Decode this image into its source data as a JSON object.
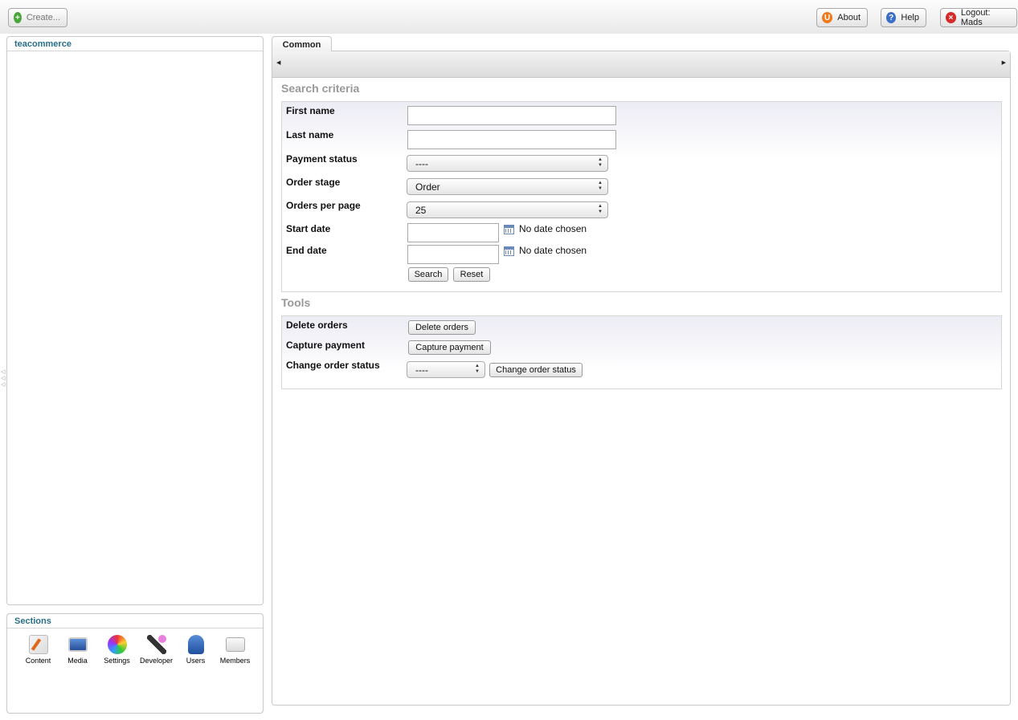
{
  "topbar": {
    "create_label": "Create...",
    "about_label": "About",
    "help_label": "Help",
    "logout_label": "Logout: Mads"
  },
  "tree": {
    "title": "teacommerce"
  },
  "sections": {
    "title": "Sections",
    "items": [
      {
        "label": "Content",
        "icon": "content-icon"
      },
      {
        "label": "Media",
        "icon": "media-icon"
      },
      {
        "label": "Settings",
        "icon": "settings-icon"
      },
      {
        "label": "Developer",
        "icon": "developer-icon"
      },
      {
        "label": "Users",
        "icon": "users-icon"
      },
      {
        "label": "Members",
        "icon": "members-icon"
      }
    ]
  },
  "main": {
    "tab": "Common",
    "search": {
      "title": "Search criteria",
      "first_name_label": "First name",
      "first_name_value": "",
      "last_name_label": "Last name",
      "last_name_value": "",
      "payment_status_label": "Payment status",
      "payment_status_value": "----",
      "order_stage_label": "Order stage",
      "order_stage_value": "Order",
      "orders_per_page_label": "Orders per page",
      "orders_per_page_value": "25",
      "start_date_label": "Start date",
      "start_date_text": "No date chosen",
      "end_date_label": "End date",
      "end_date_text": "No date chosen",
      "search_button": "Search",
      "reset_button": "Reset"
    },
    "tools": {
      "title": "Tools",
      "delete_label": "Delete orders",
      "delete_button": "Delete orders",
      "capture_label": "Capture payment",
      "capture_button": "Capture payment",
      "change_status_label": "Change order status",
      "change_status_value": "----",
      "change_status_button": "Change order status"
    }
  },
  "colors": {
    "tree_title": "#2a6f8a",
    "section_title": "#999999"
  }
}
